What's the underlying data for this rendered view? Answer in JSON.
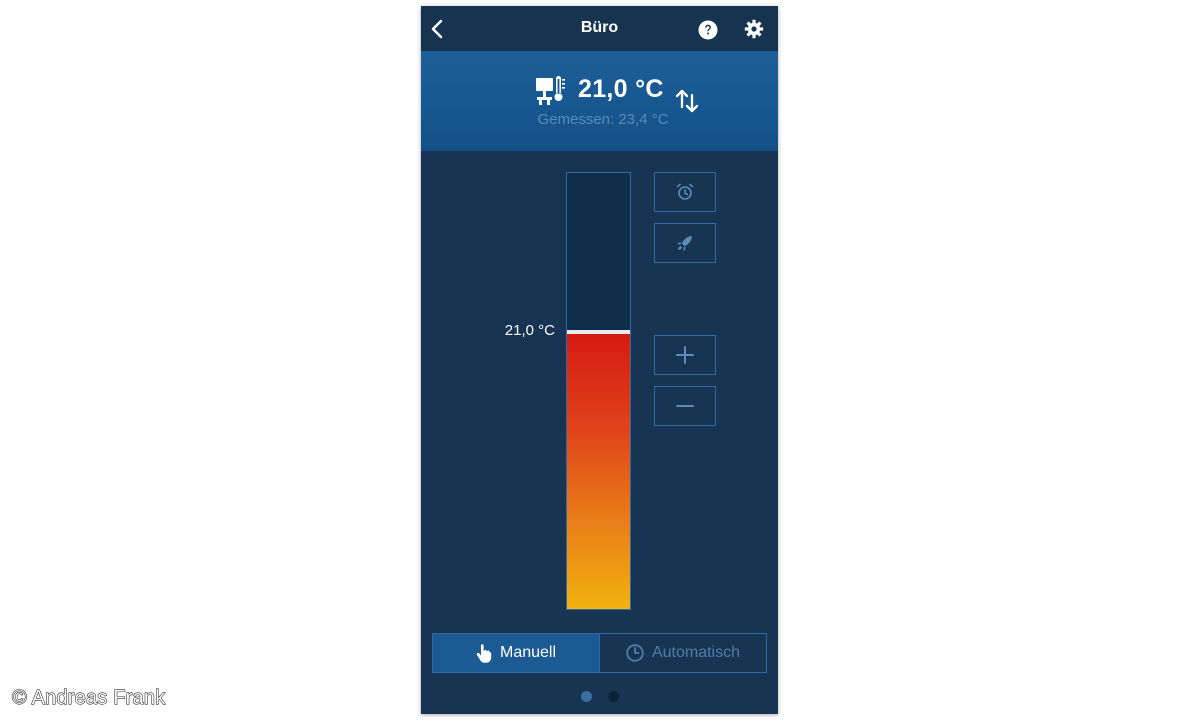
{
  "topbar": {
    "title": "Büro"
  },
  "header": {
    "setpoint": "21,0 °C",
    "measured": "Gemessen: 23,4 °C"
  },
  "control": {
    "bar_label": "21,0 °C",
    "fill_fraction": 0.635,
    "fill_colors": [
      "#d41a12",
      "#f2b20f"
    ]
  },
  "modes": {
    "manual_label": "Manuell",
    "auto_label": "Automatisch",
    "active": "manual"
  },
  "pagination": {
    "pages": 2,
    "current": 1
  },
  "icons": {
    "back": "chevron-left-icon",
    "help": "question-circle-icon",
    "settings": "gear-icon",
    "device": "radiator-thermostat-icon",
    "swap": "swap-arrows-icon",
    "alarm": "alarm-clock-icon",
    "boost": "rocket-icon",
    "plus": "plus-icon",
    "minus": "minus-icon",
    "hand": "hand-pointer-icon",
    "clock": "clock-icon"
  },
  "colors": {
    "background": "#173552",
    "header": "#17578f",
    "accent_border": "#2d6ca6",
    "active_mode": "#1b5a92"
  },
  "footer": {
    "copyright": "© Andreas Frank"
  }
}
